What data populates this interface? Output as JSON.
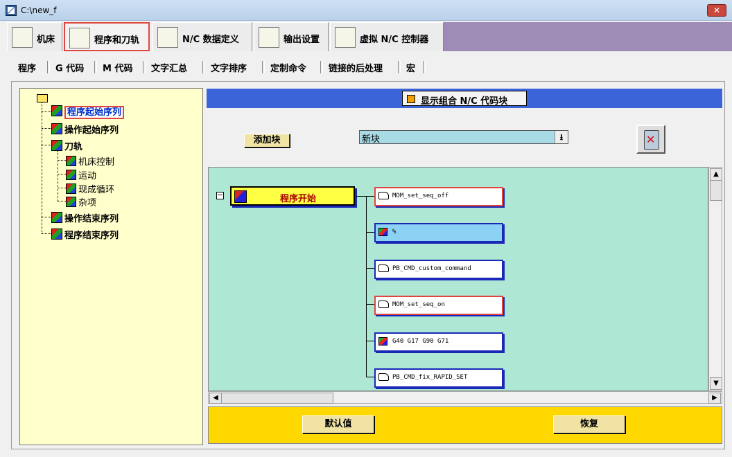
{
  "window": {
    "title": "C:\\new_f",
    "close_label": "✕"
  },
  "main_tabs": [
    {
      "label": "机床"
    },
    {
      "label": "程序和刀轨"
    },
    {
      "label": "N/C 数据定义"
    },
    {
      "label": "输出设置"
    },
    {
      "label": "虚拟 N/C 控制器"
    }
  ],
  "sub_tabs": [
    {
      "label": "程序"
    },
    {
      "label": "G 代码"
    },
    {
      "label": "M 代码"
    },
    {
      "label": "文字汇总"
    },
    {
      "label": "文字排序"
    },
    {
      "label": "定制命令"
    },
    {
      "label": "链接的后处理"
    },
    {
      "label": "宏"
    }
  ],
  "tree": {
    "items": [
      {
        "label": "程序起始序列",
        "selected": true
      },
      {
        "label": "操作起始序列"
      },
      {
        "label": "刀轨"
      },
      {
        "label": "机床控制"
      },
      {
        "label": "运动"
      },
      {
        "label": "现成循环"
      },
      {
        "label": "杂项"
      },
      {
        "label": "操作结束序列"
      },
      {
        "label": "程序结束序列"
      }
    ]
  },
  "header": {
    "show_combined_label": "显示组合 N/C 代码块"
  },
  "toolbar": {
    "add_block_label": "添加块",
    "new_block_value": "新块",
    "dropdown_arrow": "⭳"
  },
  "canvas": {
    "start_block_label": "程序开始",
    "collapse_symbol": "−",
    "blocks": [
      {
        "label": "MOM_set_seq_off",
        "icon": "hand-icon"
      },
      {
        "label": "%",
        "icon": "cube-icon"
      },
      {
        "label": "PB_CMD_custom_command",
        "icon": "hand-icon"
      },
      {
        "label": "MOM_set_seq_on",
        "icon": "hand-icon"
      },
      {
        "label": "G40 G17 G90 G71",
        "icon": "cube-icon"
      },
      {
        "label": "PB_CMD_fix_RAPID_SET",
        "icon": "hand-icon"
      }
    ]
  },
  "scroll": {
    "up": "▲",
    "down": "▼",
    "left": "◀",
    "right": "▶"
  },
  "footer": {
    "default_label": "默认值",
    "restore_label": "恢复"
  }
}
